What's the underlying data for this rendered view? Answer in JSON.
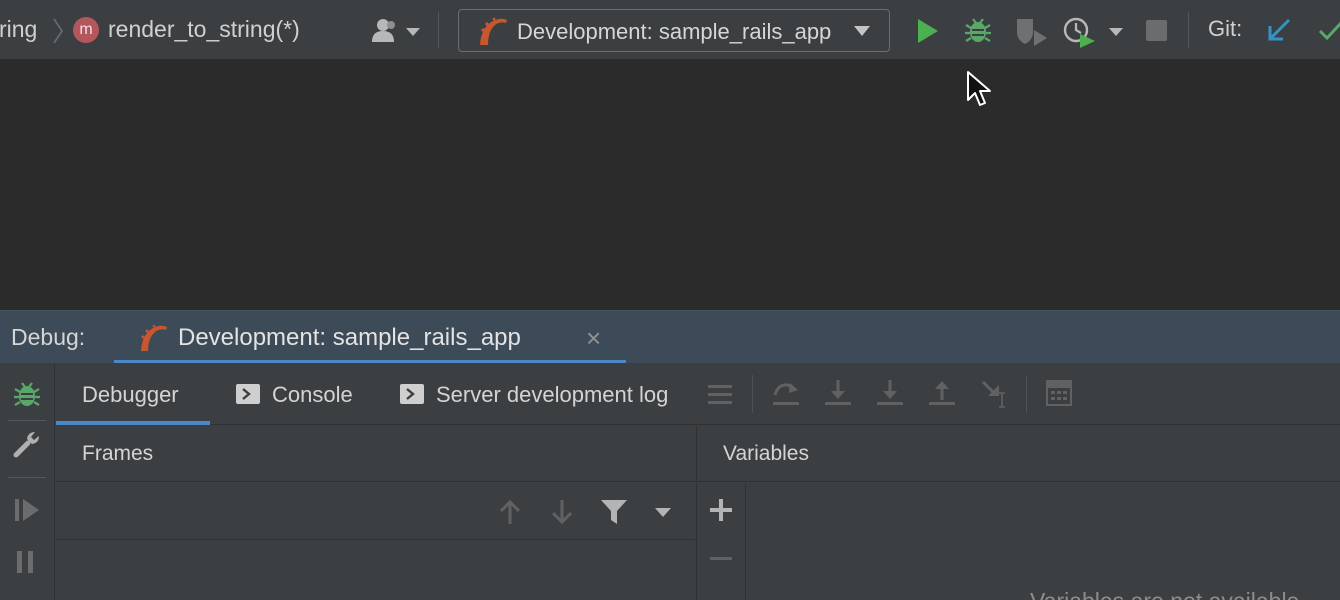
{
  "toolbar": {
    "breadcrumb_prev": "ring",
    "method_badge": "m",
    "method_name": "render_to_string(*)",
    "run_config": "Development: sample_rails_app",
    "git_label": "Git:"
  },
  "debug": {
    "label": "Debug:",
    "session_tab": "Development: sample_rails_app",
    "close_glyph": "×"
  },
  "subtabs": {
    "debugger": "Debugger",
    "console": "Console",
    "server_log": "Server development log"
  },
  "panes": {
    "frames": "Frames",
    "variables": "Variables",
    "variables_empty": "Variables are not available"
  },
  "colors": {
    "run_green": "#4caf50",
    "bug_green": "#59a869",
    "git_blue": "#3592c4",
    "accent_underline": "#4a88c7",
    "debug_bar": "#3d4a57"
  },
  "icons": [
    "user-icon",
    "rails-icon",
    "run-icon",
    "debug-icon",
    "coverage-icon",
    "profile-icon",
    "stop-icon",
    "git-update-icon",
    "git-commit-icon",
    "debug-bug-icon",
    "settings-wrench-icon",
    "resume-icon",
    "pause-icon",
    "terminal-icon",
    "list-icon",
    "step-over-icon",
    "step-into-icon",
    "force-step-into-icon",
    "step-out-icon",
    "run-to-cursor-icon",
    "calculator-icon",
    "arrow-up-icon",
    "arrow-down-icon",
    "filter-icon",
    "dropdown-icon",
    "plus-icon",
    "minus-icon"
  ]
}
